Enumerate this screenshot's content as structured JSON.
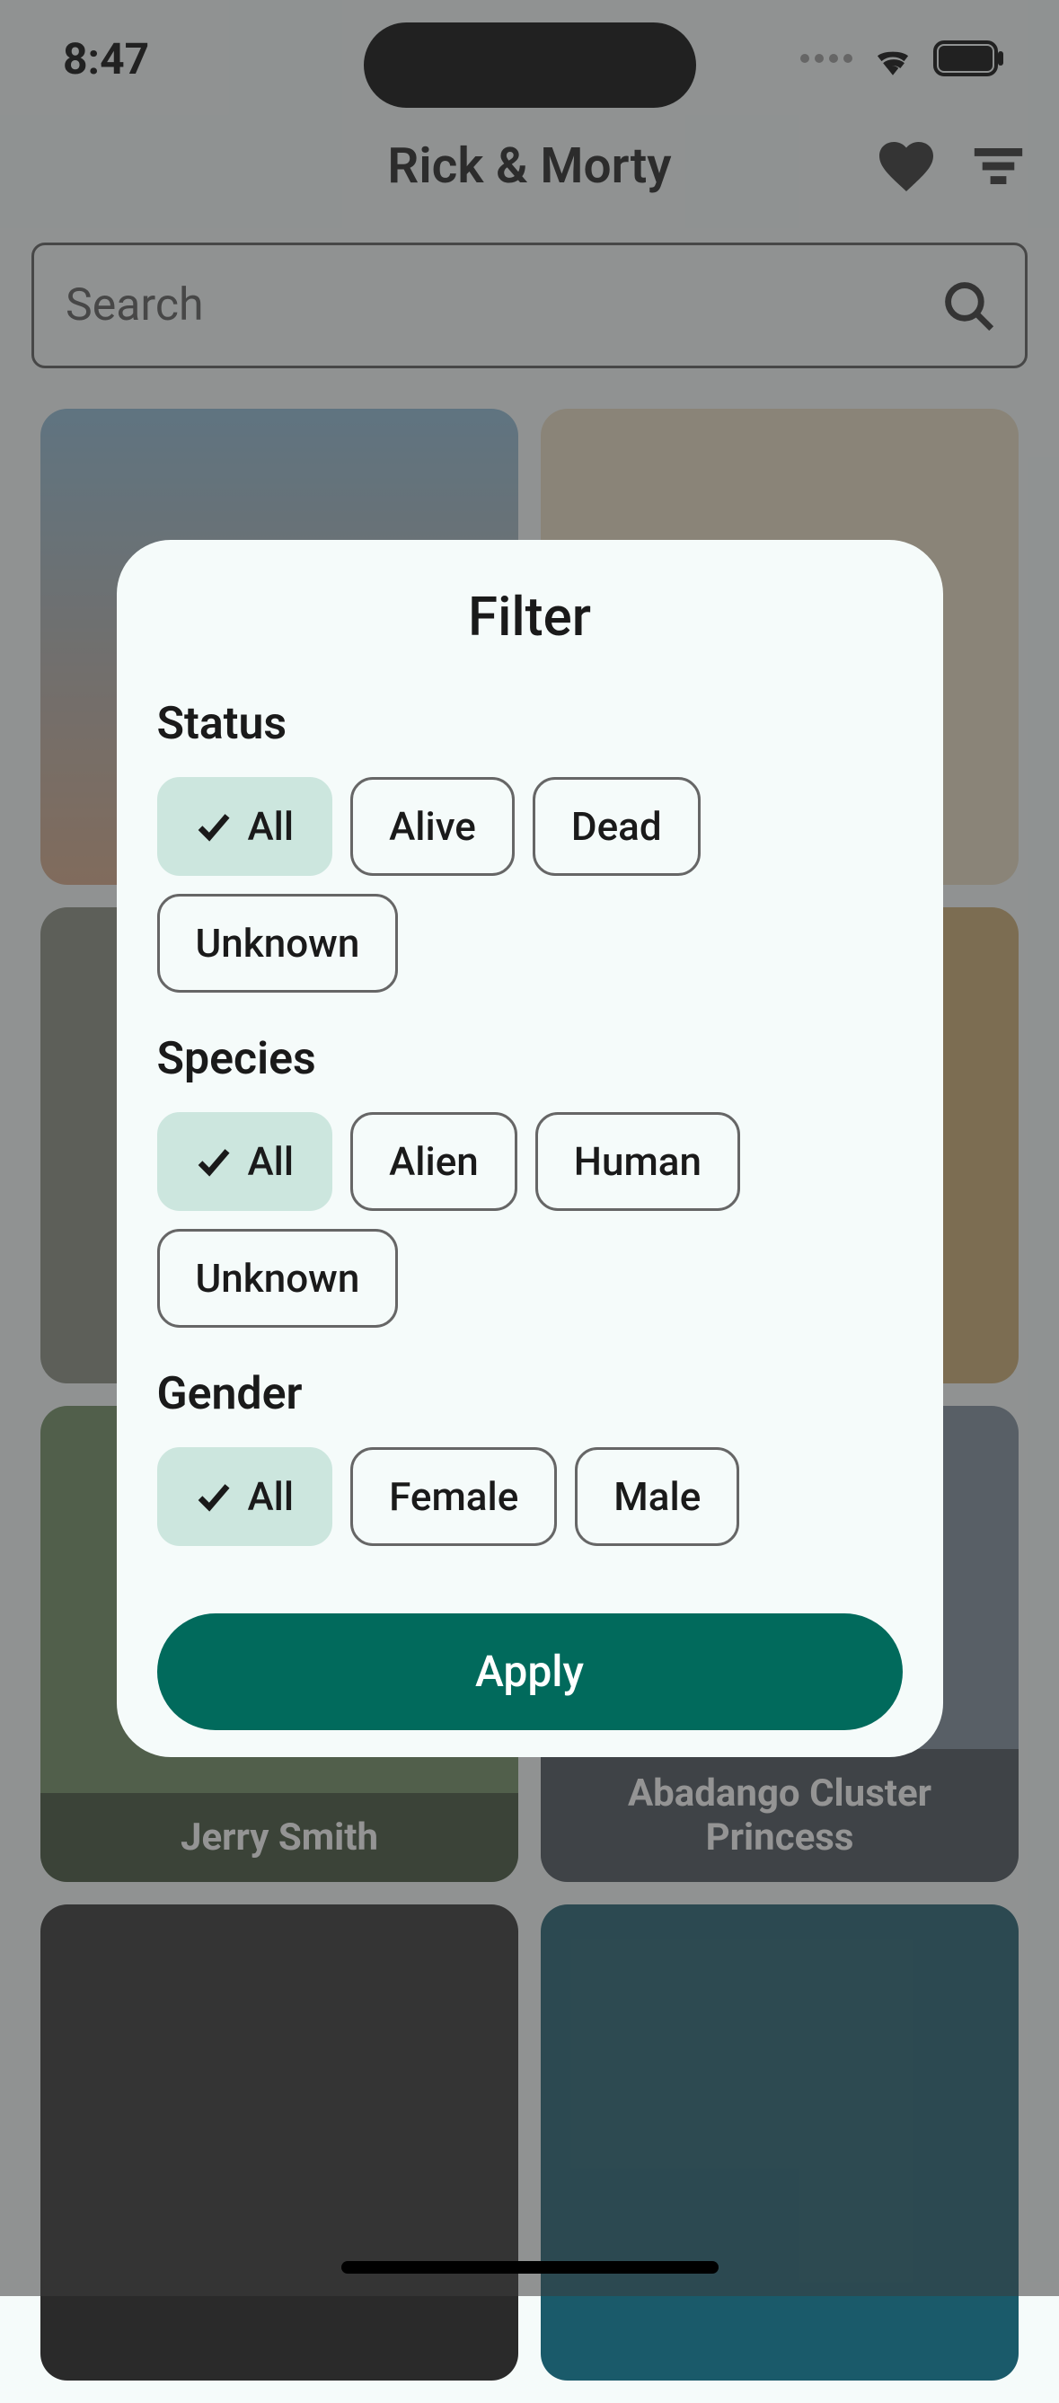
{
  "statusBar": {
    "time": "8:47"
  },
  "header": {
    "title": "Rick & Morty"
  },
  "search": {
    "placeholder": "Search"
  },
  "cards": [
    {
      "name": ""
    },
    {
      "name": ""
    },
    {
      "name": ""
    },
    {
      "name": ""
    },
    {
      "name": "Jerry Smith"
    },
    {
      "name": "Abadango Cluster Princess"
    },
    {
      "name": ""
    },
    {
      "name": ""
    }
  ],
  "modal": {
    "title": "Filter",
    "sections": {
      "status": {
        "label": "Status",
        "options": [
          "All",
          "Alive",
          "Dead",
          "Unknown"
        ],
        "selected": "All"
      },
      "species": {
        "label": "Species",
        "options": [
          "All",
          "Alien",
          "Human",
          "Unknown"
        ],
        "selected": "All"
      },
      "gender": {
        "label": "Gender",
        "options": [
          "All",
          "Female",
          "Male"
        ],
        "selected": "All"
      }
    },
    "applyLabel": "Apply"
  }
}
